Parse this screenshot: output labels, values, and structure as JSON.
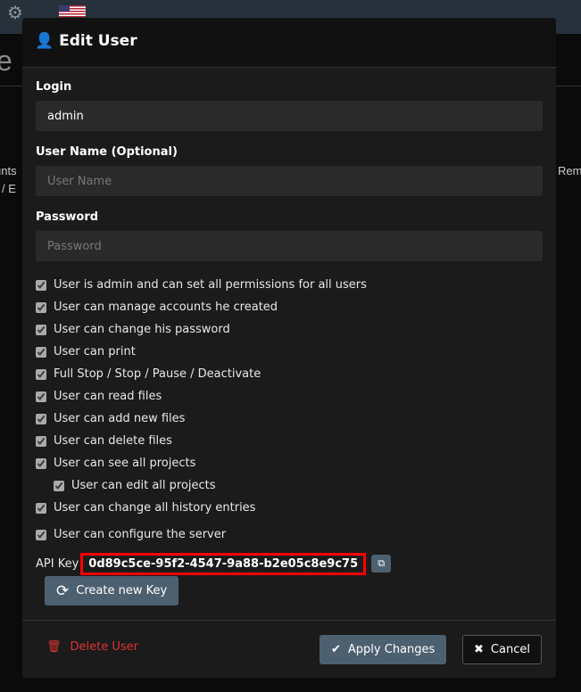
{
  "background": {
    "left_fragments": [
      "e",
      "unts",
      "/ E"
    ],
    "right_fragment": "Rem"
  },
  "modal": {
    "title": "Edit User",
    "icon": "user-icon",
    "login": {
      "label": "Login",
      "value": "admin"
    },
    "username": {
      "label": "User Name (Optional)",
      "value": "",
      "placeholder": "User Name"
    },
    "password": {
      "label": "Password",
      "value": "",
      "placeholder": "Password"
    },
    "permissions": [
      {
        "label": "User is admin and can set all permissions for all users",
        "checked": true
      },
      {
        "label": "User can manage accounts he created",
        "checked": true
      },
      {
        "label": "User can change his password",
        "checked": true
      },
      {
        "label": "User can print",
        "checked": true
      },
      {
        "label": "Full Stop / Stop / Pause / Deactivate",
        "checked": true
      },
      {
        "label": "User can read files",
        "checked": true
      },
      {
        "label": "User can add new files",
        "checked": true
      },
      {
        "label": "User can delete files",
        "checked": true
      },
      {
        "label": "User can see all projects",
        "checked": true
      },
      {
        "label": "User can edit all projects",
        "checked": true
      },
      {
        "label": "User can change all history entries",
        "checked": true
      },
      {
        "label": "User can configure the server",
        "checked": true
      }
    ],
    "api_key_label": "API Key",
    "api_key": "0d89c5ce-95f2-4547-9a88-b2e05c8e9c75",
    "create_key": "Create new Key",
    "delete": "Delete User",
    "apply": "Apply Changes",
    "cancel": "Cancel"
  },
  "colors": {
    "highlight": "#ff0000",
    "danger": "#dd3333",
    "button": "#4d6070"
  }
}
